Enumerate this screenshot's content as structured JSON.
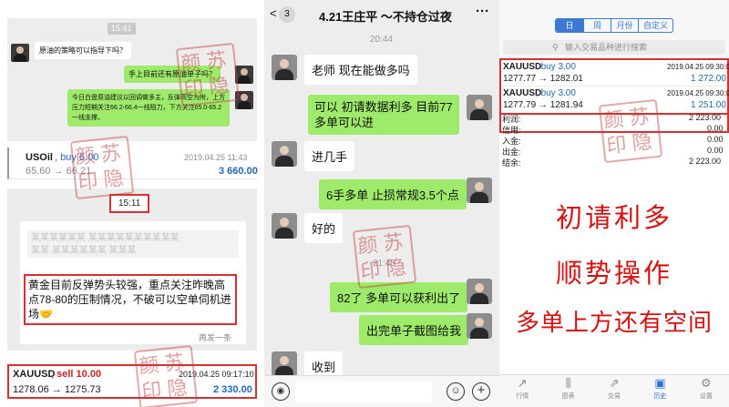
{
  "left": {
    "chat": {
      "time": "15:41",
      "msg1": "原油的策略可以指导下吗？",
      "msg2": "手上目前还有原油单子吗？",
      "msg3": "今日白盘原油建议以回调做多主，反弹高空为附，上方压力短期关注66.2-66.4一线阻力，下方关注65.0-65.2一线支撑。"
    },
    "trade1": {
      "symbol": "USOil",
      "action": "buy 6.00",
      "datetime": "2019.04.25 11:43",
      "price_from": "65.60",
      "arrow": "→",
      "price_to": "66.21",
      "profit": "3 660.00"
    },
    "chat2": {
      "time": "15:11",
      "blurred_line1": "某某某某某某 某某某某某某某某某某",
      "blurred_line2": "某某 某某某某某某 某某某",
      "highlight": "黄金目前反弹势头较强，重点关注昨晚高点78-80的压制情况，不破可以空单伺机进场",
      "emoji": "🤝",
      "reply_label": "再发一条"
    },
    "trade2": {
      "symbol": "XAUUSD",
      "action": "sell 10.00",
      "datetime": "2019.04.25 09:17:10",
      "price_from": "1278.06",
      "arrow": "→",
      "price_to": "1275.73",
      "profit": "2 330.00"
    }
  },
  "middle": {
    "header": {
      "back_count": "3",
      "title": "4.21王庄平 ～不持仓过夜",
      "more": "···"
    },
    "time1": "20:44",
    "time2": "21:43",
    "messages": [
      {
        "text": "老师 现在能做多吗",
        "side": "left"
      },
      {
        "text": "可以 初请数据利多 目前77多单可以进",
        "side": "right"
      },
      {
        "text": "进几手",
        "side": "left"
      },
      {
        "text": "6手多单 止损常规3.5个点",
        "side": "right"
      },
      {
        "text": "好的",
        "side": "left"
      },
      {
        "text": "82了 多单可以获利出了",
        "side": "right"
      },
      {
        "text": "出完单子截图给我",
        "side": "right"
      },
      {
        "text": "收到",
        "side": "left"
      }
    ]
  },
  "right": {
    "tabs": [
      "日",
      "周",
      "月份",
      "自定义"
    ],
    "search": {
      "placeholder": "输入交易品种进行搜索"
    },
    "trades": [
      {
        "symbol": "XAUUSD",
        "action": "buy 3.00",
        "datetime": "2019.04.25 09:30:05",
        "price_from": "1277.77",
        "arrow": "→",
        "price_to": "1282.01",
        "profit": "1 272.00"
      },
      {
        "symbol": "XAUUSD",
        "action": "buy 3.00",
        "datetime": "2019.04.25 09:30:03",
        "price_from": "1277.79",
        "arrow": "→",
        "price_to": "1281.94",
        "profit": "1 251.00"
      }
    ],
    "summary": [
      {
        "label": "利润:",
        "value": "2 223.00"
      },
      {
        "label": "信用:",
        "value": "0.00"
      },
      {
        "label": "入金:",
        "value": "0.00"
      },
      {
        "label": "出金:",
        "value": "0.00"
      },
      {
        "label": "结余:",
        "value": "2 223.00"
      }
    ],
    "big_text": [
      "初请利多",
      "顺势操作",
      "多单上方还有空间"
    ],
    "nav": [
      "行情",
      "图表",
      "交易",
      "历史",
      "设置"
    ]
  },
  "seal_text": [
    "苏",
    "颜",
    "隐",
    "印"
  ],
  "colors": {
    "green_bubble": "#9eea6a",
    "blue": "#2368b8",
    "red": "#cc1f1f",
    "accent_red": "#d81010"
  }
}
